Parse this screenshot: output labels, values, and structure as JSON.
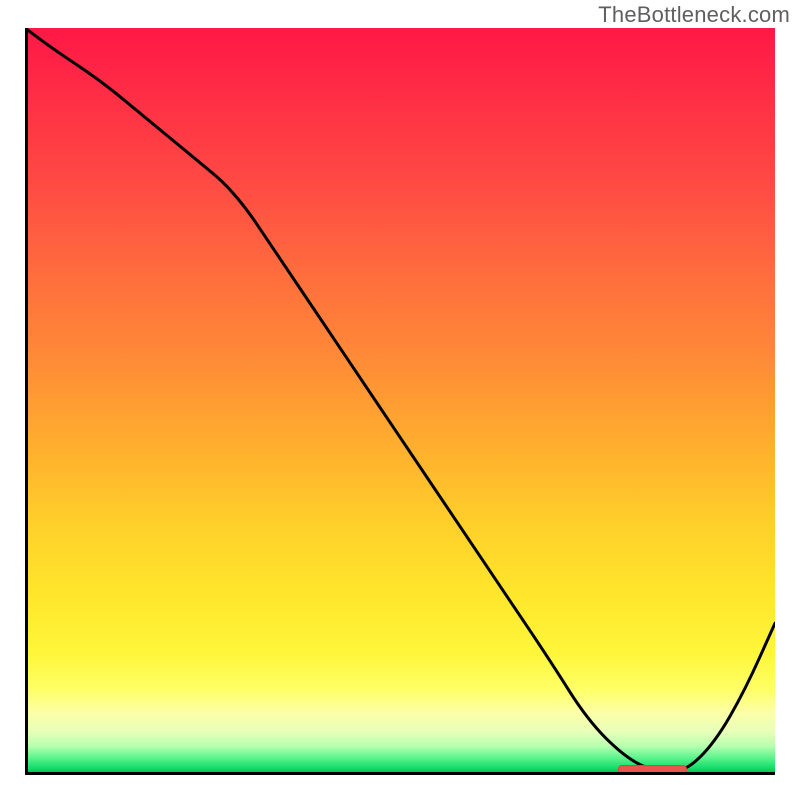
{
  "watermark": "TheBottleneck.com",
  "colors": {
    "axis": "#000000",
    "curve": "#000000",
    "marker": "#e7564b",
    "gradient_top": "#ff1846",
    "gradient_bottom": "#00c94f"
  },
  "chart_data": {
    "type": "line",
    "title": "",
    "xlabel": "",
    "ylabel": "",
    "xlim": [
      0,
      100
    ],
    "ylim": [
      0,
      100
    ],
    "x": [
      0,
      4,
      10,
      16,
      22,
      28,
      34,
      40,
      46,
      52,
      58,
      64,
      70,
      75,
      80,
      84,
      88,
      92,
      96,
      100
    ],
    "values": [
      100,
      97,
      93,
      88,
      83,
      78,
      69,
      60,
      51,
      42,
      33,
      24,
      15,
      7,
      2,
      0,
      0,
      4,
      11,
      20
    ],
    "annotations": [
      {
        "kind": "marker-band",
        "x_start": 79,
        "x_end": 88,
        "y": 0.4
      }
    ]
  }
}
